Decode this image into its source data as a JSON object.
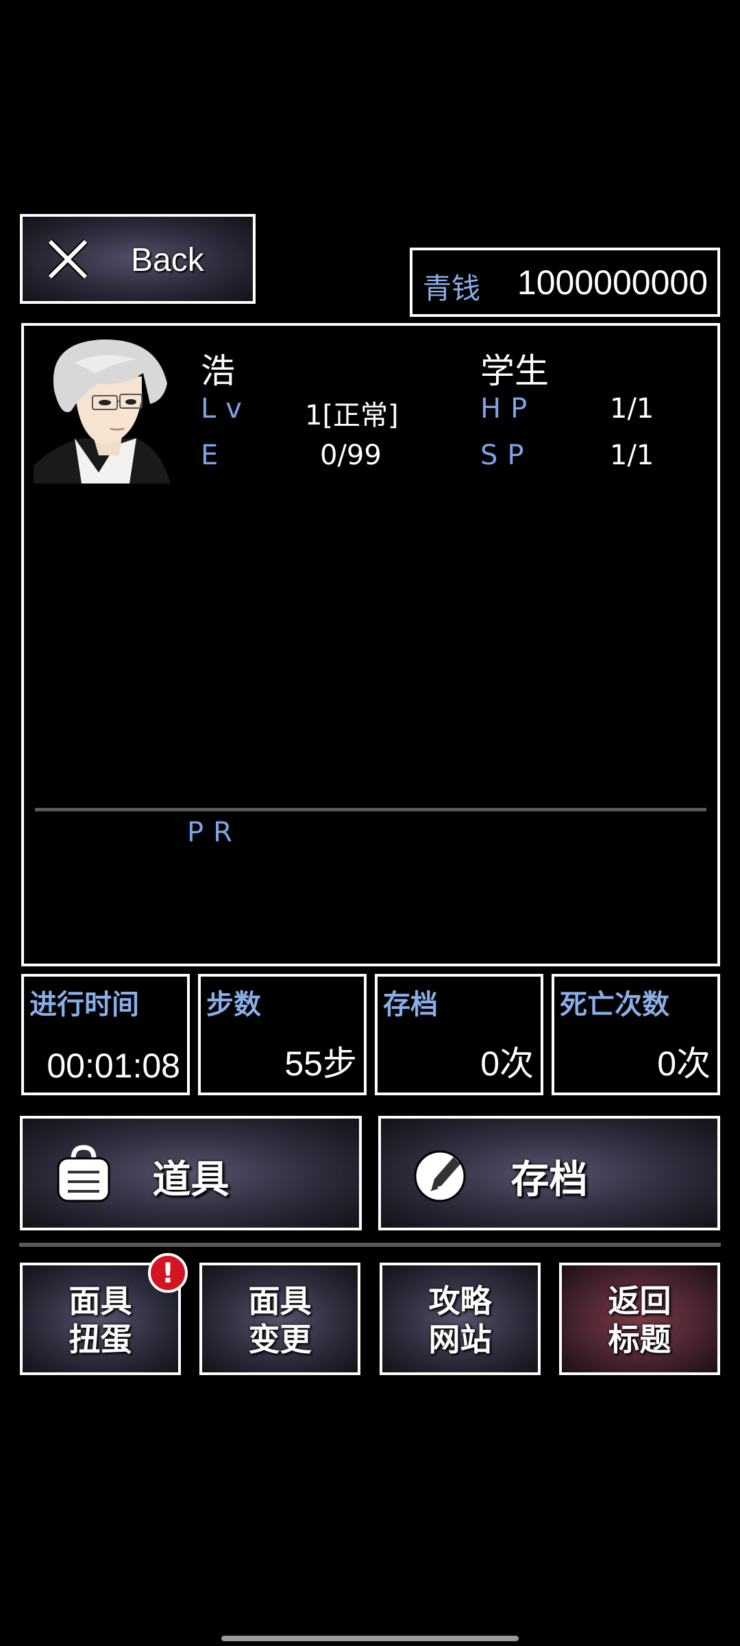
{
  "back_button": {
    "label": "Back"
  },
  "money": {
    "label": "青钱",
    "value": "1000000000"
  },
  "character": {
    "name": "浩",
    "job": "学生",
    "lv_label": "Lv",
    "lv_value": "1[正常]",
    "hp_label": "HP",
    "hp_value": "1/1",
    "e_label": "E",
    "e_value": "0/99",
    "sp_label": "SP",
    "sp_value": "1/1",
    "pr_label": "PR"
  },
  "info": [
    {
      "title": "进行时间",
      "value": "00:01:08"
    },
    {
      "title": "步数",
      "value": "55步"
    },
    {
      "title": "存档",
      "value": "0次"
    },
    {
      "title": "死亡次数",
      "value": "0次"
    }
  ],
  "actions": {
    "items_label": "道具",
    "save_label": "存档"
  },
  "menu": {
    "mask_gacha": "面具\n扭蛋",
    "mask_change": "面具\n变更",
    "guide_site": "攻略\n网站",
    "return_title": "返回\n标题",
    "alert_symbol": "!"
  },
  "colors": {
    "label_blue": "#7ea2e6",
    "alert_red": "#d41420",
    "background": "#000000"
  }
}
